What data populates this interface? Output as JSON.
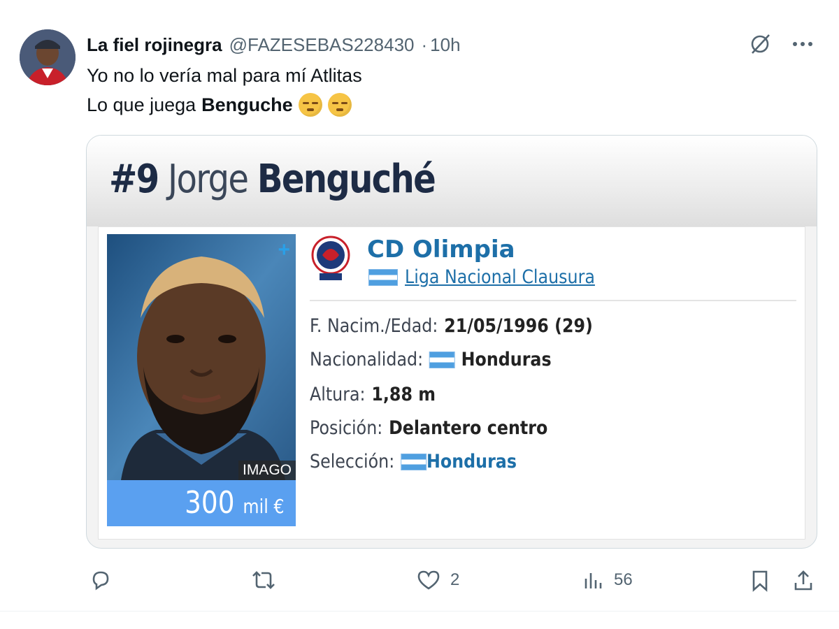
{
  "tweet": {
    "display_name": "La fiel rojinegra",
    "handle": "@FAZESEBAS228430",
    "separator": "·",
    "time": "10h",
    "line1": "Yo no lo vería mal para mí Atlitas",
    "line2_prefix": "Lo que juega",
    "line2_bold": "Benguche",
    "emojis": [
      "pensive-face-emoji",
      "pensive-face-emoji"
    ]
  },
  "card": {
    "number": "#9",
    "first_name": "Jorge",
    "last_name": "Benguché",
    "photo_credit": "IMAGO",
    "plus_icon": "+",
    "market_value": "300",
    "market_value_unit": "mil €",
    "club": "CD Olimpia",
    "league": "Liga Nacional Clausura",
    "rows": [
      {
        "label": "F. Nacim./Edad:",
        "value": "21/05/1996 (29)"
      },
      {
        "label": "Nacionalidad:",
        "value": "Honduras"
      },
      {
        "label": "Altura:",
        "value": "1,88 m"
      },
      {
        "label": "Posición:",
        "value": "Delantero centro"
      },
      {
        "label": "Selección:",
        "value": "Honduras"
      }
    ]
  },
  "actions": {
    "reply_count": "",
    "retweet_count": "",
    "like_count": "2",
    "views_count": "56"
  },
  "colors": {
    "accent_blue": "#1d6fa8",
    "value_box": "#5aa0f0",
    "text_secondary": "#536471"
  },
  "icons": {
    "grok": "grok-icon",
    "more": "more-icon",
    "reply": "reply-icon",
    "retweet": "retweet-icon",
    "like": "heart-icon",
    "views": "views-icon",
    "bookmark": "bookmark-icon",
    "share": "share-icon"
  }
}
